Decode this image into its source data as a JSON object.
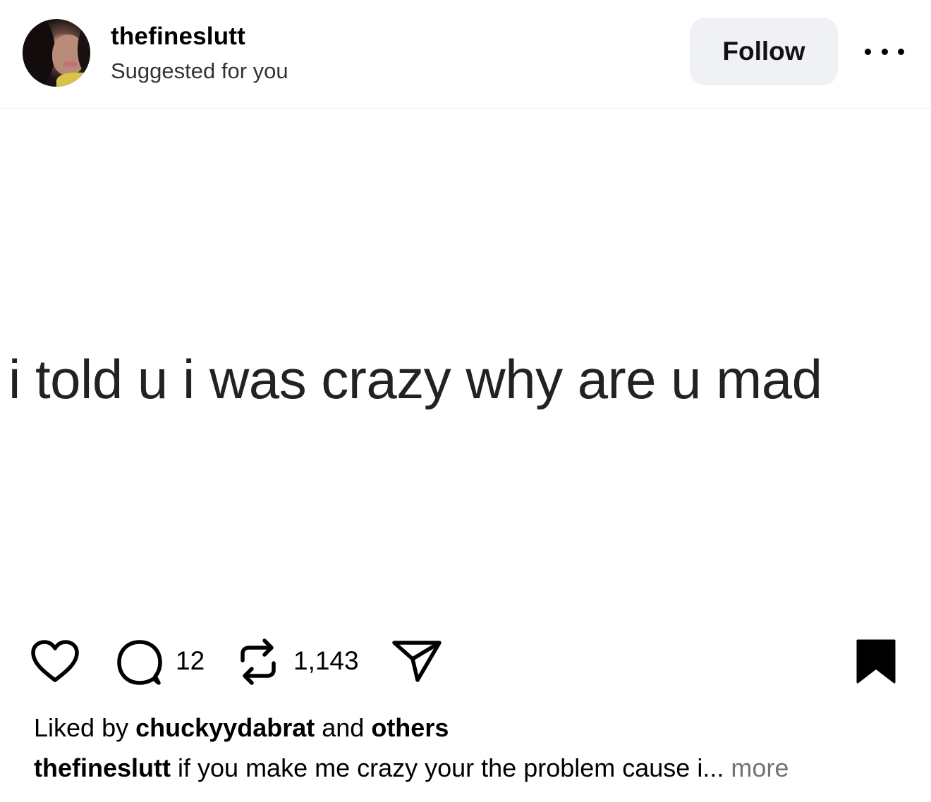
{
  "post": {
    "username": "thefineslutt",
    "subtitle": "Suggested for you",
    "follow_label": "Follow",
    "image_text": "i told u i was crazy why are u mad"
  },
  "actions": {
    "comment_count": "12",
    "repost_count": "1,143"
  },
  "likes": {
    "prefix": "Liked by",
    "user": "chuckyydabrat",
    "conjunction": "and",
    "others": "others"
  },
  "caption": {
    "username": "thefineslutt",
    "text": "if you make me crazy your the problem cause i...",
    "more_label": "more"
  },
  "icons": {
    "like": "heart-icon",
    "comment": "comment-bubble-icon",
    "repost": "repost-icon",
    "share": "send-icon",
    "save": "bookmark-icon",
    "more": "more-dots-icon"
  }
}
